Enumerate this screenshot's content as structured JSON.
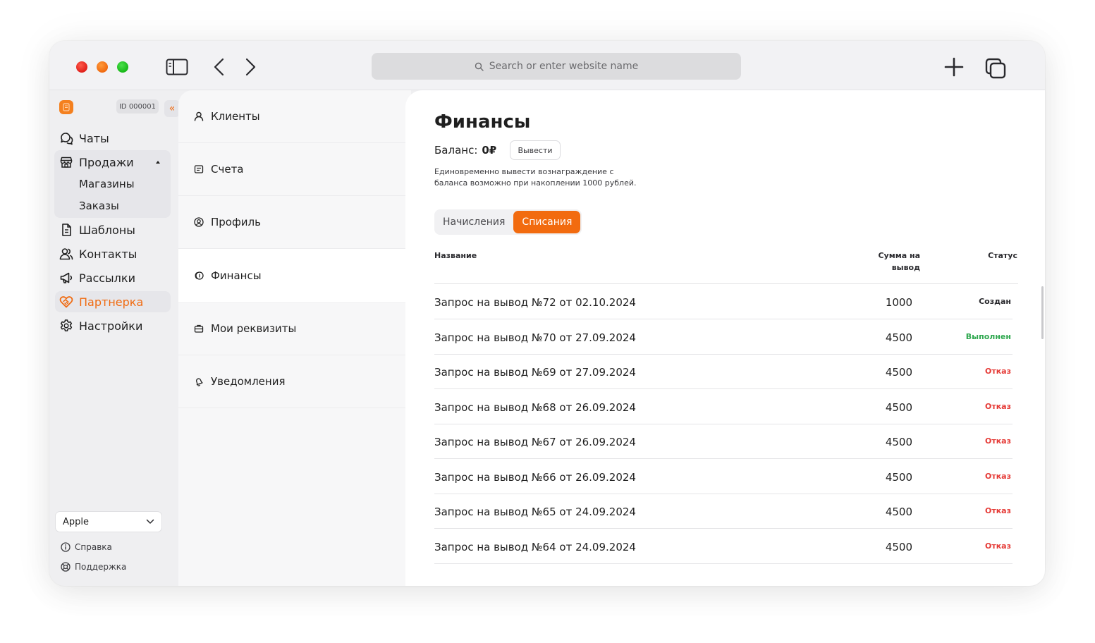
{
  "browser": {
    "address_placeholder": "Search or enter website name"
  },
  "sidebar": {
    "account_id": "ID 000001",
    "collapse_glyph": "«",
    "items": [
      {
        "label": "Чаты",
        "icon": "chat-icon"
      },
      {
        "label": "Продажи",
        "icon": "store-icon",
        "expanded": true,
        "children": [
          {
            "label": "Магазины"
          },
          {
            "label": "Заказы"
          }
        ]
      },
      {
        "label": "Шаблоны",
        "icon": "document-icon"
      },
      {
        "label": "Контакты",
        "icon": "users-icon"
      },
      {
        "label": "Рассылки",
        "icon": "megaphone-icon"
      },
      {
        "label": "Партнерка",
        "icon": "handshake-icon",
        "active": true
      },
      {
        "label": "Настройки",
        "icon": "gear-icon"
      }
    ],
    "store_select": {
      "value": "Apple"
    },
    "footer": [
      {
        "label": "Справка",
        "icon": "info-icon"
      },
      {
        "label": "Поддержка",
        "icon": "lifebuoy-icon"
      }
    ]
  },
  "settings_menu": {
    "items": [
      {
        "label": "Клиенты",
        "icon": "user-icon"
      },
      {
        "label": "Счета",
        "icon": "invoice-icon"
      },
      {
        "label": "Профиль",
        "icon": "profile-icon"
      },
      {
        "label": "Финансы",
        "icon": "coins-icon",
        "active": true
      },
      {
        "label": "Мои реквизиты",
        "icon": "briefcase-icon"
      },
      {
        "label": "Уведомления",
        "icon": "bell-icon"
      }
    ]
  },
  "finance": {
    "title": "Финансы",
    "balance_label": "Баланс:",
    "balance_value": "0₽",
    "withdraw_button": "Вывести",
    "hint_line1": "Единовременно вывести вознаграждение с",
    "hint_line2": "баланса возможно при накоплении 1000 рублей.",
    "tabs": [
      {
        "label": "Начисления",
        "active": false
      },
      {
        "label": "Списания",
        "active": true
      }
    ],
    "columns": {
      "name": "Название",
      "amount_line1": "Сумма на",
      "amount_line2": "вывод",
      "status": "Статус"
    },
    "rows": [
      {
        "name": "Запрос на вывод №72 от 02.10.2024",
        "amount": "1000",
        "status": "Создан",
        "status_color": "#2a2a2e"
      },
      {
        "name": "Запрос на вывод №70 от 27.09.2024",
        "amount": "4500",
        "status": "Выполнен",
        "status_color": "#2fa84f"
      },
      {
        "name": "Запрос на вывод №69 от 27.09.2024",
        "amount": "4500",
        "status": "Отказ",
        "status_color": "#e53935"
      },
      {
        "name": "Запрос на вывод №68 от 26.09.2024",
        "amount": "4500",
        "status": "Отказ",
        "status_color": "#e53935"
      },
      {
        "name": "Запрос на вывод №67 от 26.09.2024",
        "amount": "4500",
        "status": "Отказ",
        "status_color": "#e53935"
      },
      {
        "name": "Запрос на вывод №66 от 26.09.2024",
        "amount": "4500",
        "status": "Отказ",
        "status_color": "#e53935"
      },
      {
        "name": "Запрос на вывод №65 от 24.09.2024",
        "amount": "4500",
        "status": "Отказ",
        "status_color": "#e53935"
      },
      {
        "name": "Запрос на вывод №64 от 24.09.2024",
        "amount": "4500",
        "status": "Отказ",
        "status_color": "#e53935"
      }
    ]
  },
  "colors": {
    "accent": "#f26b0f",
    "success": "#2fa84f",
    "danger": "#e53935"
  }
}
